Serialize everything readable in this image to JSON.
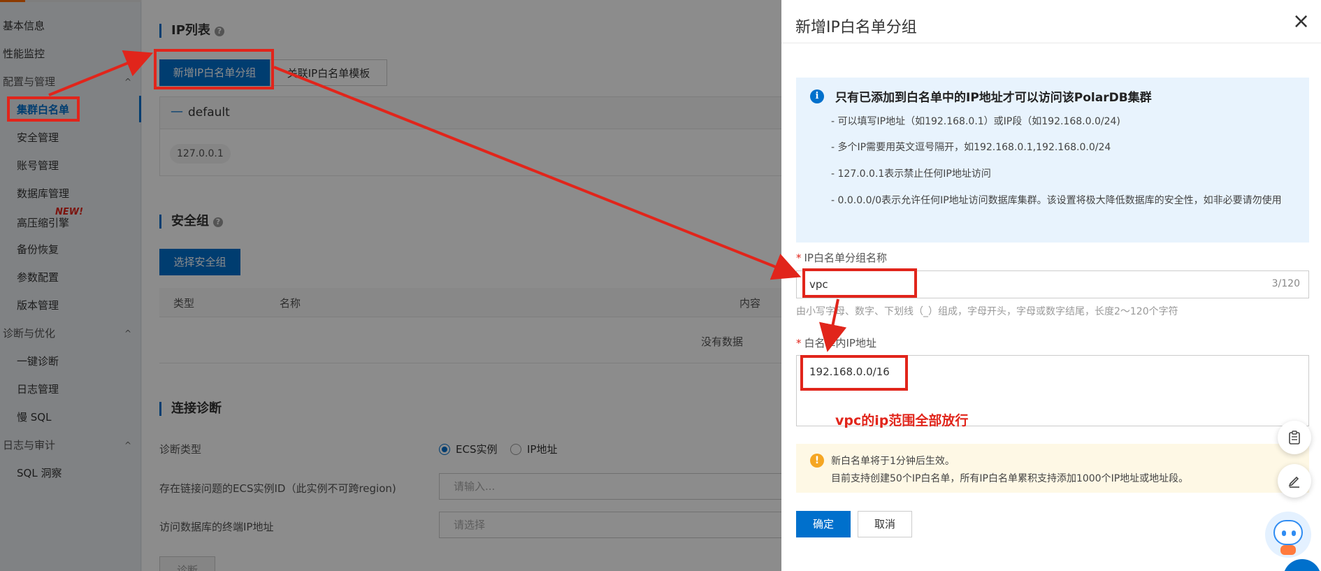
{
  "sidebar": {
    "items": [
      {
        "label": "基本信息"
      },
      {
        "label": "性能监控"
      },
      {
        "label": "配置与管理"
      },
      {
        "label": "集群白名单"
      },
      {
        "label": "安全管理"
      },
      {
        "label": "账号管理"
      },
      {
        "label": "数据库管理"
      },
      {
        "label": "高压缩引擎"
      },
      {
        "label": "备份恢复"
      },
      {
        "label": "参数配置"
      },
      {
        "label": "版本管理"
      },
      {
        "label": "诊断与优化"
      },
      {
        "label": "一键诊断"
      },
      {
        "label": "日志管理"
      },
      {
        "label": "慢 SQL"
      },
      {
        "label": "日志与审计"
      },
      {
        "label": "SQL 洞察"
      }
    ],
    "new_badge": "NEW!",
    "chevron": "^"
  },
  "main": {
    "ip_list": {
      "title": "IP列表",
      "add_group_button": "新增IP白名单分组",
      "link_template_button": "关联IP白名单模板",
      "group_name": "default",
      "group_collapse": "—",
      "ips": [
        "127.0.0.1"
      ]
    },
    "security_group": {
      "title": "安全组",
      "select_button": "选择安全组",
      "columns": [
        "类型",
        "名称",
        "内容"
      ],
      "empty_text": "没有数据"
    },
    "conn_diag": {
      "title": "连接诊断",
      "type_label": "诊断类型",
      "options": [
        "ECS实例",
        "IP地址"
      ],
      "selected_option": "ECS实例",
      "ecs_label": "存在链接问题的ECS实例ID（此实例不可跨region)",
      "ecs_placeholder": "请输入...",
      "ip_label": "访问数据库的终端IP地址",
      "ip_placeholder": "请选择",
      "diag_button": "诊断"
    },
    "help_glyph": "?"
  },
  "drawer": {
    "title": "新增IP白名单分组",
    "close": "×",
    "info": {
      "icon_glyph": "i",
      "title": "只有已添加到白名单中的IP地址才可以访问该PolarDB集群",
      "lines": [
        "- 可以填写IP地址（如192.168.0.1）或IP段（如192.168.0.0/24)",
        "- 多个IP需要用英文逗号隔开，如192.168.0.1,192.168.0.0/24",
        "- 127.0.0.1表示禁止任何IP地址访问",
        "- 0.0.0.0/0表示允许任何IP地址访问数据库集群。该设置将极大降低数据库的安全性，如非必要请勿使用"
      ]
    },
    "required_mark": "*",
    "name_field": {
      "label": "IP白名单分组名称",
      "value": "vpc",
      "counter": "3/120",
      "hint": "由小写字母、数字、下划线（_）组成，字母开头，字母或数字结尾，长度2～120个字符"
    },
    "ip_field": {
      "label": "白名单内IP地址",
      "value": "192.168.0.0/16"
    },
    "warning": {
      "icon_glyph": "!",
      "line1": "新白名单将于1分钟后生效。",
      "line2": "目前支持创建50个IP白名单，所有IP白名单累积支持添加1000个IP地址或地址段。"
    },
    "ok_button": "确定",
    "cancel_button": "取消"
  },
  "annotation": {
    "text": "vpc的ip范围全部放行",
    "color": "#e1251b"
  },
  "colors": {
    "primary": "#0070cc",
    "annotation_red": "#e1251b",
    "info_bg": "#e8f3fd",
    "warning_bg": "#fef8e5"
  }
}
